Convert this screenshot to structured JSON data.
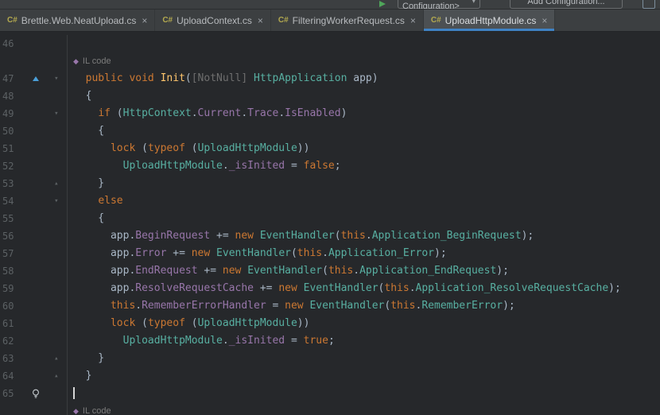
{
  "topbar": {
    "config_dropdown": "<No Configuration>",
    "dropdown_arrow": "▾",
    "add_config_button": "Add Configuration..."
  },
  "tabs": [
    {
      "icon": "C#",
      "label": "Brettle.Web.NeatUpload.cs",
      "close": "×",
      "active": false
    },
    {
      "icon": "C#",
      "label": "UploadContext.cs",
      "close": "×",
      "active": false
    },
    {
      "icon": "C#",
      "label": "FilteringWorkerRequest.cs",
      "close": "×",
      "active": false
    },
    {
      "icon": "C#",
      "label": "UploadHttpModule.cs",
      "close": "×",
      "active": true
    }
  ],
  "editor": {
    "il_label": "IL code",
    "colors": {
      "d": "#a9b7c6",
      "k": "#cc7832",
      "t": "#58b0a2",
      "m": "#9876aa",
      "f": "#ffc66d",
      "r": "#58b0a2",
      "a": "#6e6e6e"
    },
    "rows": [
      {
        "num": "46",
        "seg": []
      },
      {
        "inlay": true,
        "text": "IL code"
      },
      {
        "num": "47",
        "icon": "bookmark-arrow",
        "fold": "open",
        "seg": [
          [
            "  ",
            "d"
          ],
          [
            "public",
            "k"
          ],
          [
            " ",
            "d"
          ],
          [
            "void",
            "k"
          ],
          [
            " ",
            "d"
          ],
          [
            "Init",
            "f"
          ],
          [
            "(",
            "d"
          ],
          [
            "[NotNull] ",
            "a"
          ],
          [
            "HttpApplication",
            "t"
          ],
          [
            " app)",
            "d"
          ]
        ]
      },
      {
        "num": "48",
        "seg": [
          [
            "  {",
            "d"
          ]
        ]
      },
      {
        "num": "49",
        "fold": "open",
        "seg": [
          [
            "    ",
            "d"
          ],
          [
            "if",
            "k"
          ],
          [
            " (",
            "d"
          ],
          [
            "HttpContext",
            "t"
          ],
          [
            ".",
            "d"
          ],
          [
            "Current",
            "m"
          ],
          [
            ".",
            "d"
          ],
          [
            "Trace",
            "m"
          ],
          [
            ".",
            "d"
          ],
          [
            "IsEnabled",
            "m"
          ],
          [
            ")",
            "d"
          ]
        ]
      },
      {
        "num": "50",
        "seg": [
          [
            "    {",
            "d"
          ]
        ]
      },
      {
        "num": "51",
        "seg": [
          [
            "      ",
            "d"
          ],
          [
            "lock",
            "k"
          ],
          [
            " (",
            "d"
          ],
          [
            "typeof",
            "k"
          ],
          [
            " (",
            "d"
          ],
          [
            "UploadHttpModule",
            "t"
          ],
          [
            "))",
            "d"
          ]
        ]
      },
      {
        "num": "52",
        "seg": [
          [
            "        ",
            "d"
          ],
          [
            "UploadHttpModule",
            "t"
          ],
          [
            ".",
            "d"
          ],
          [
            "_isInited",
            "m"
          ],
          [
            " = ",
            "d"
          ],
          [
            "false",
            "k"
          ],
          [
            ";",
            "d"
          ]
        ]
      },
      {
        "num": "53",
        "fold": "close",
        "seg": [
          [
            "    }",
            "d"
          ]
        ]
      },
      {
        "num": "54",
        "fold": "open",
        "seg": [
          [
            "    ",
            "d"
          ],
          [
            "else",
            "k"
          ]
        ]
      },
      {
        "num": "55",
        "seg": [
          [
            "    {",
            "d"
          ]
        ]
      },
      {
        "num": "56",
        "seg": [
          [
            "      app.",
            "d"
          ],
          [
            "BeginRequest",
            "m"
          ],
          [
            " += ",
            "d"
          ],
          [
            "new",
            "k"
          ],
          [
            " ",
            "d"
          ],
          [
            "EventHandler",
            "t"
          ],
          [
            "(",
            "d"
          ],
          [
            "this",
            "k"
          ],
          [
            ".",
            "d"
          ],
          [
            "Application_BeginRequest",
            "r"
          ],
          [
            ");",
            "d"
          ]
        ]
      },
      {
        "num": "57",
        "seg": [
          [
            "      app.",
            "d"
          ],
          [
            "Error",
            "m"
          ],
          [
            " += ",
            "d"
          ],
          [
            "new",
            "k"
          ],
          [
            " ",
            "d"
          ],
          [
            "EventHandler",
            "t"
          ],
          [
            "(",
            "d"
          ],
          [
            "this",
            "k"
          ],
          [
            ".",
            "d"
          ],
          [
            "Application_Error",
            "r"
          ],
          [
            ");",
            "d"
          ]
        ]
      },
      {
        "num": "58",
        "seg": [
          [
            "      app.",
            "d"
          ],
          [
            "EndRequest",
            "m"
          ],
          [
            " += ",
            "d"
          ],
          [
            "new",
            "k"
          ],
          [
            " ",
            "d"
          ],
          [
            "EventHandler",
            "t"
          ],
          [
            "(",
            "d"
          ],
          [
            "this",
            "k"
          ],
          [
            ".",
            "d"
          ],
          [
            "Application_EndRequest",
            "r"
          ],
          [
            ");",
            "d"
          ]
        ]
      },
      {
        "num": "59",
        "seg": [
          [
            "      app.",
            "d"
          ],
          [
            "ResolveRequestCache",
            "m"
          ],
          [
            " += ",
            "d"
          ],
          [
            "new",
            "k"
          ],
          [
            " ",
            "d"
          ],
          [
            "EventHandler",
            "t"
          ],
          [
            "(",
            "d"
          ],
          [
            "this",
            "k"
          ],
          [
            ".",
            "d"
          ],
          [
            "Application_ResolveRequestCache",
            "r"
          ],
          [
            ");",
            "d"
          ]
        ]
      },
      {
        "num": "60",
        "seg": [
          [
            "      ",
            "d"
          ],
          [
            "this",
            "k"
          ],
          [
            ".",
            "d"
          ],
          [
            "RememberErrorHandler",
            "m"
          ],
          [
            " = ",
            "d"
          ],
          [
            "new",
            "k"
          ],
          [
            " ",
            "d"
          ],
          [
            "EventHandler",
            "t"
          ],
          [
            "(",
            "d"
          ],
          [
            "this",
            "k"
          ],
          [
            ".",
            "d"
          ],
          [
            "RememberError",
            "r"
          ],
          [
            ");",
            "d"
          ]
        ]
      },
      {
        "num": "61",
        "seg": [
          [
            "      ",
            "d"
          ],
          [
            "lock",
            "k"
          ],
          [
            " (",
            "d"
          ],
          [
            "typeof",
            "k"
          ],
          [
            " (",
            "d"
          ],
          [
            "UploadHttpModule",
            "t"
          ],
          [
            "))",
            "d"
          ]
        ]
      },
      {
        "num": "62",
        "seg": [
          [
            "        ",
            "d"
          ],
          [
            "UploadHttpModule",
            "t"
          ],
          [
            ".",
            "d"
          ],
          [
            "_isInited",
            "m"
          ],
          [
            " = ",
            "d"
          ],
          [
            "true",
            "k"
          ],
          [
            ";",
            "d"
          ]
        ]
      },
      {
        "num": "63",
        "fold": "close",
        "seg": [
          [
            "    }",
            "d"
          ]
        ]
      },
      {
        "num": "64",
        "fold": "close",
        "seg": [
          [
            "  }",
            "d"
          ]
        ]
      },
      {
        "num": "65",
        "icon": "lightbulb",
        "caret": true,
        "seg": []
      },
      {
        "inlay": true,
        "text": "IL code"
      }
    ]
  }
}
